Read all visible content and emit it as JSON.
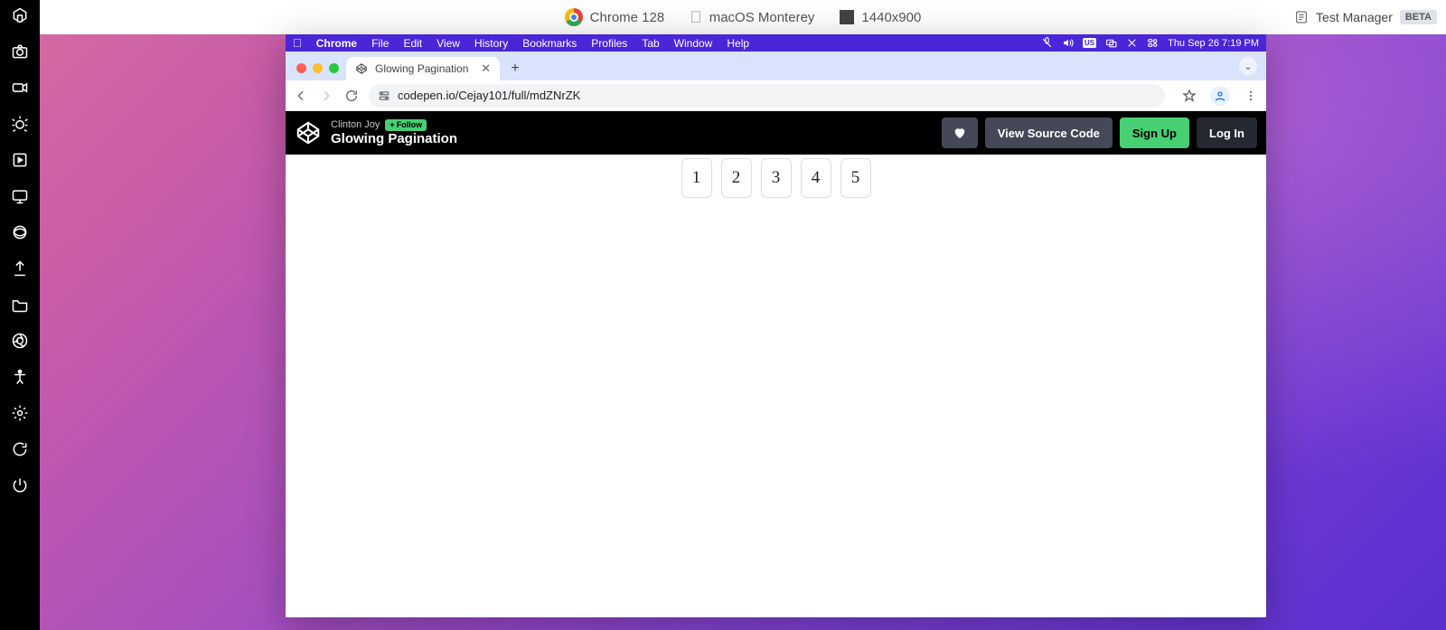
{
  "topbar": {
    "browser": "Chrome 128",
    "os": "macOS Monterey",
    "resolution": "1440x900",
    "test_manager": "Test Manager",
    "beta": "BETA"
  },
  "menubar": {
    "app": "Chrome",
    "items": [
      "File",
      "Edit",
      "View",
      "History",
      "Bookmarks",
      "Profiles",
      "Tab",
      "Window",
      "Help"
    ],
    "clock": "Thu Sep 26  7:19 PM",
    "input_label": "US"
  },
  "tab": {
    "title": "Glowing Pagination"
  },
  "address": {
    "url": "codepen.io/Cejay101/full/mdZNrZK"
  },
  "codepen": {
    "author": "Clinton Joy",
    "follow": "Follow",
    "title": "Glowing Pagination",
    "view_source": "View Source Code",
    "signup": "Sign Up",
    "login": "Log In"
  },
  "pagination": [
    "1",
    "2",
    "3",
    "4",
    "5"
  ]
}
